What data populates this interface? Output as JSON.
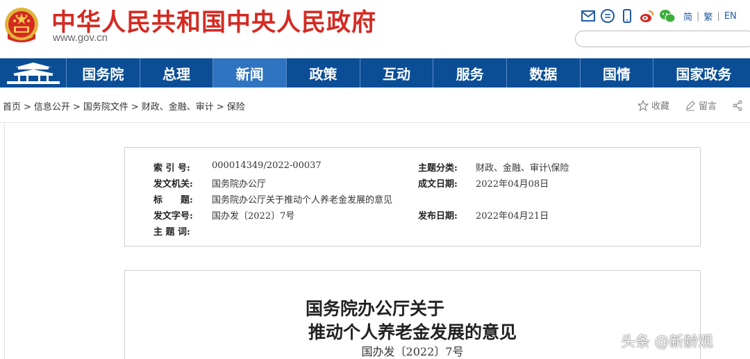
{
  "header": {
    "site_title": "中华人民共和国中央人民政府",
    "site_domain": "www.gov.cn",
    "tool_icons": [
      "mail-icon",
      "message-icon",
      "mobile-icon",
      "weibo-icon",
      "wechat-icon"
    ],
    "languages": [
      "简",
      "繁",
      "EN"
    ]
  },
  "nav": {
    "items": [
      "国务院",
      "总理",
      "新闻",
      "政策",
      "互动",
      "服务",
      "数据",
      "国情",
      "国家政务"
    ],
    "active": "新闻"
  },
  "breadcrumb": {
    "items": [
      "首页",
      "信息公开",
      "国务院文件",
      "财政、金融、审计",
      "保险"
    ],
    "separator": ">"
  },
  "actions": {
    "favorite": "收藏",
    "comment": "留言"
  },
  "meta": {
    "index_label": "索 引 号:",
    "index_value": "000014349/2022-00037",
    "category_label": "主题分类:",
    "category_value": "财政、金融、审计\\保险",
    "issuer_label": "发文机关:",
    "issuer_value": "国务院办公厅",
    "written_date_label": "成文日期:",
    "written_date_value": "2022年04月08日",
    "title_label": "标　　题:",
    "title_value": "国务院办公厅关于推动个人养老金发展的意见",
    "doc_number_label": "发文字号:",
    "doc_number_value": "国办发〔2022〕7号",
    "publish_date_label": "发布日期:",
    "publish_date_value": "2022年04月21日",
    "keywords_label": "主 题 词:",
    "keywords_value": ""
  },
  "document": {
    "title_line1": "国务院办公厅关于",
    "title_line2": "推动个人养老金发展的意见",
    "number": "国办发〔2022〕7号"
  },
  "watermark": "头条 @新龄观",
  "colors": {
    "brand_red": "#d42a22",
    "nav_blue": "#0b4e96",
    "nav_active": "#2f74c0",
    "link_blue": "#1e5aa8"
  }
}
